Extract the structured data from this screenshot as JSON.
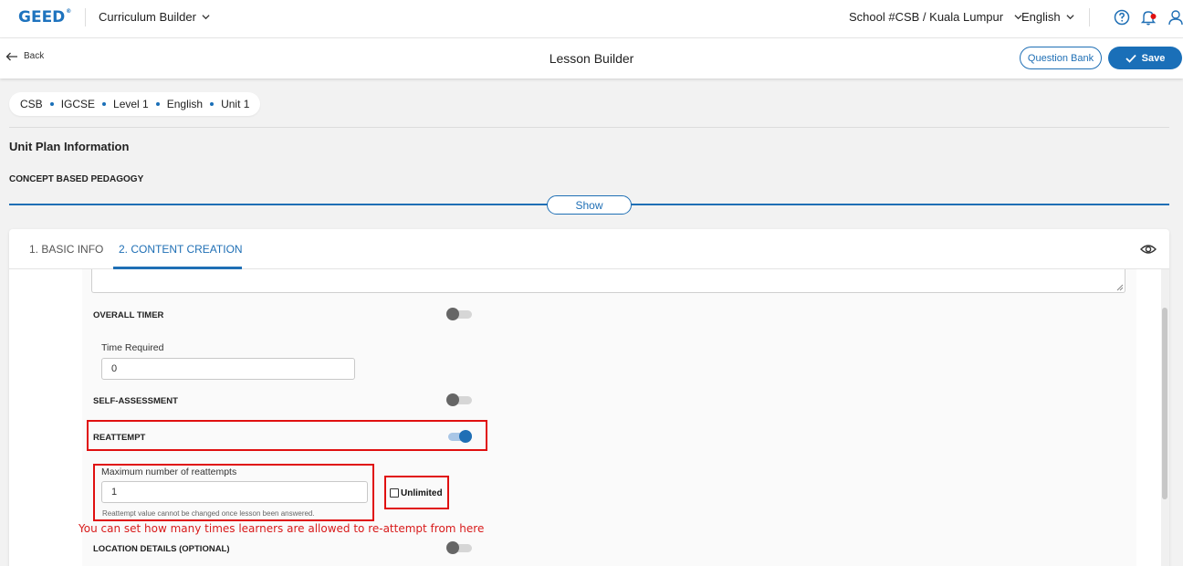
{
  "topbar": {
    "logo": "GEED",
    "logo_mark": "®",
    "module": "Curriculum Builder",
    "school": "School #CSB / Kuala Lumpur",
    "language": "English",
    "icons": [
      "help-icon",
      "bell-icon",
      "user-icon"
    ],
    "notification_dot_color": "#e01010"
  },
  "lesson_header": {
    "back": "Back",
    "title": "Lesson Builder",
    "question_bank": "Question Bank",
    "save": "Save"
  },
  "breadcrumb": [
    "CSB",
    "IGCSE",
    "Level 1",
    "English",
    "Unit 1"
  ],
  "unit_plan": {
    "title": "Unit Plan Information",
    "subtitle": "CONCEPT BASED PEDAGOGY",
    "show": "Show"
  },
  "tabs": [
    {
      "label": "1. BASIC INFO",
      "active": false
    },
    {
      "label": "2. CONTENT CREATION",
      "active": true
    }
  ],
  "settings": {
    "overall_timer": {
      "label": "OVERALL TIMER",
      "enabled": false
    },
    "time_required": {
      "label": "Time Required",
      "value": "0"
    },
    "self_assessment": {
      "label": "SELF-ASSESSMENT",
      "enabled": false
    },
    "reattempt": {
      "label": "REATTEMPT",
      "enabled": true
    },
    "max_reattempts": {
      "label": "Maximum number of reattempts",
      "value": "1",
      "hint": "Reattempt value cannot be changed once lesson been answered."
    },
    "unlimited": {
      "label": "Unlimited",
      "checked": false
    },
    "location": {
      "label": "LOCATION DETAILS (OPTIONAL)",
      "enabled": false
    }
  },
  "annotation": {
    "note": "You can set how many times learners are allowed to re-attempt from here",
    "color": "#e01010"
  },
  "colors": {
    "primary": "#1f6fb5",
    "toggle_off_knob": "#666666",
    "highlight": "#e01010"
  }
}
